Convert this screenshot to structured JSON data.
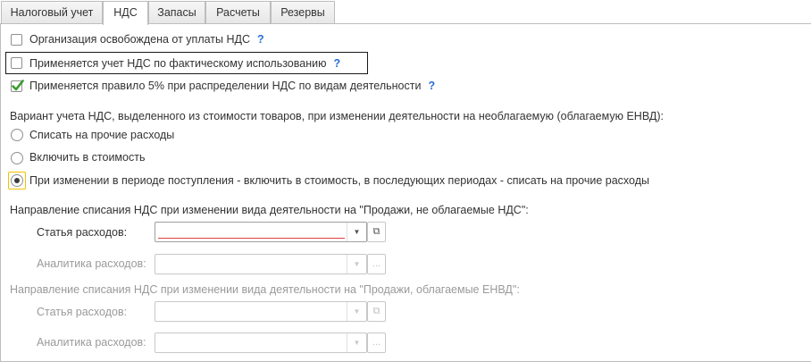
{
  "tabs": [
    {
      "label": "Налоговый учет",
      "active": false
    },
    {
      "label": "НДС",
      "active": true
    },
    {
      "label": "Запасы",
      "active": false
    },
    {
      "label": "Расчеты",
      "active": false
    },
    {
      "label": "Резервы",
      "active": false
    }
  ],
  "checkboxes": [
    {
      "label": "Организация освобождена от уплаты НДС",
      "checked": false,
      "help": "?"
    },
    {
      "label": "Применяется учет НДС по фактическому использованию",
      "checked": false,
      "help": "?"
    },
    {
      "label": "Применяется правило 5% при распределении НДС по видам деятельности",
      "checked": true,
      "help": "?"
    }
  ],
  "variant": {
    "title": "Вариант учета НДС, выделенного из стоимости товаров, при изменении деятельности на необлагаемую (облагаемую ЕНВД):",
    "options": [
      {
        "label": "Списать на прочие расходы",
        "selected": false
      },
      {
        "label": "Включить в стоимость",
        "selected": false
      },
      {
        "label": "При изменении в периоде поступления - включить в стоимость, в последующих периодах - списать на прочие расходы",
        "selected": true
      }
    ]
  },
  "section_untaxed": {
    "title": "Направление списания НДС при изменении вида деятельности на \"Продажи, не облагаемые НДС\":",
    "expense_item_label": "Статья расходов:",
    "expense_item_value": "",
    "analytics_label": "Аналитика расходов:",
    "analytics_value": ""
  },
  "section_envd": {
    "title": "Направление списания НДС при изменении вида деятельности на \"Продажи, облагаемые ЕНВД\":",
    "expense_item_label": "Статья расходов:",
    "expense_item_value": "",
    "analytics_label": "Аналитика расходов:",
    "analytics_value": ""
  },
  "icons": {
    "dropdown": "▼",
    "open": "⧉",
    "select": "..."
  },
  "colors": {
    "help": "#2a6fd6",
    "check": "#3a9a2e",
    "required_underline": "#e04040",
    "focus_radio": "#f2c200"
  }
}
